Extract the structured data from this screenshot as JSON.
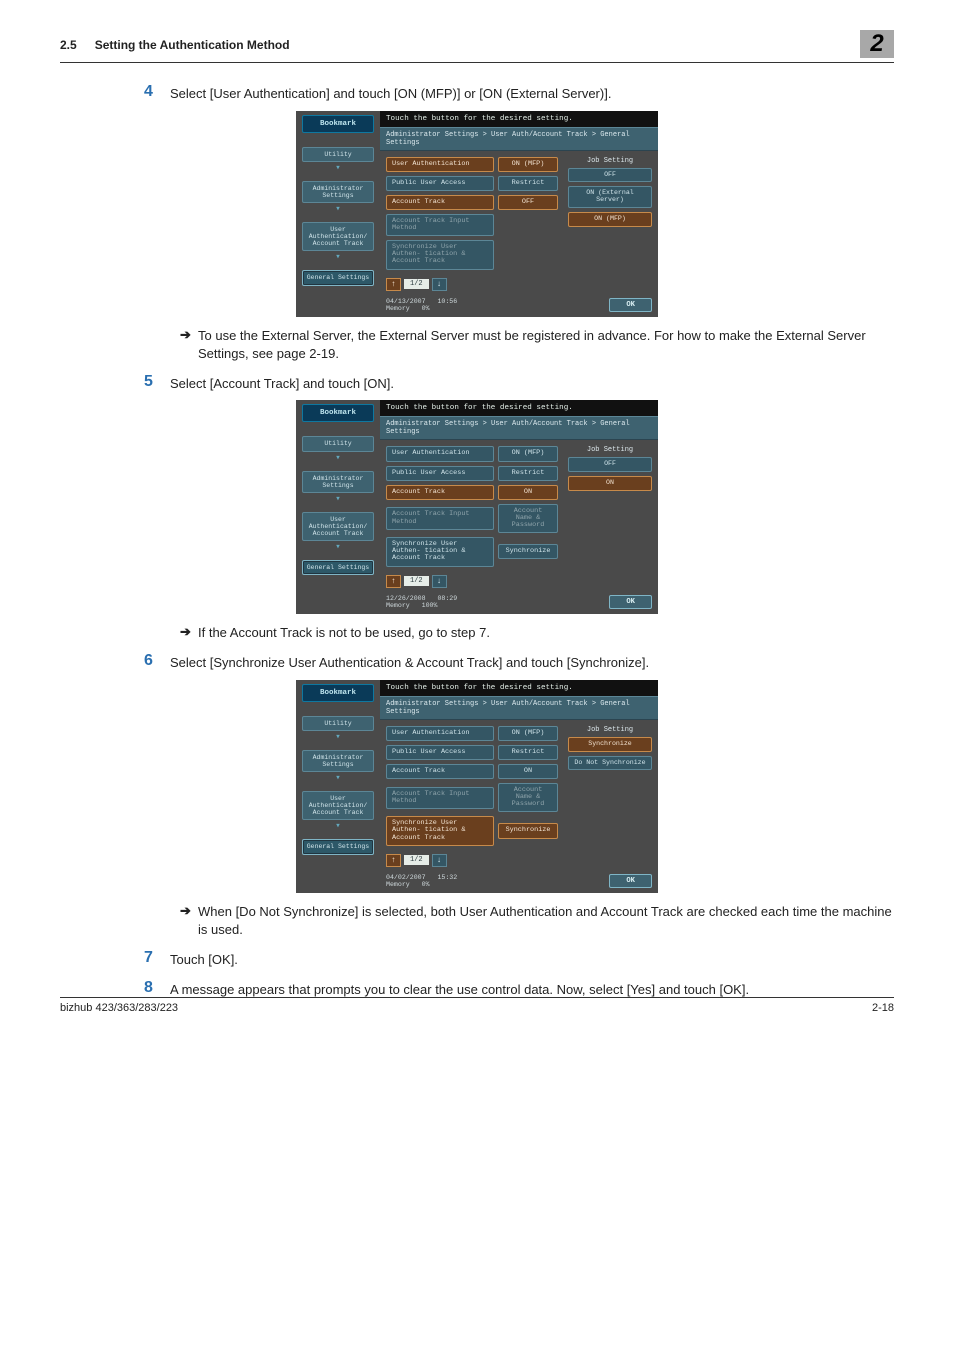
{
  "header": {
    "section_num": "2.5",
    "section_title": "Setting the Authentication Method",
    "chapter": "2"
  },
  "steps": {
    "s4": {
      "num": "4",
      "text": "Select [User Authentication] and touch [ON (MFP)] or [ON (External Server)]."
    },
    "n4": "To use the External Server, the External Server must be registered in advance. For how to make the External Server Settings, see page 2-19.",
    "s5": {
      "num": "5",
      "text": "Select [Account Track] and touch [ON]."
    },
    "n5": "If the Account Track is not to be used, go to step 7.",
    "s6": {
      "num": "6",
      "text": "Select [Synchronize User Authentication & Account Track] and touch [Synchronize]."
    },
    "n6": "When [Do Not Synchronize] is selected, both User Authentication and Account Track are checked each time the machine is used.",
    "s7": {
      "num": "7",
      "text": "Touch [OK]."
    },
    "s8": {
      "num": "8",
      "text": "A message appears that prompts you to clear the use control data. Now, select [Yes] and touch [OK]."
    }
  },
  "panel_common": {
    "title": "Touch the button for the desired setting.",
    "breadcrumb": "Administrator Settings > User Auth/Account Track  > General Settings",
    "bookmark": "Bookmark",
    "left_nav": [
      "Utility",
      "Administrator\nSettings",
      "User\nAuthentication/\nAccount Track",
      "General Settings"
    ],
    "job_setting": "Job Setting",
    "pager": "1/2",
    "ok": "OK",
    "memory_label": "Memory"
  },
  "panel1": {
    "rows": [
      {
        "label": "User Authentication",
        "val": "ON (MFP)",
        "sel": true
      },
      {
        "label": "Public User Access",
        "val": "Restrict"
      },
      {
        "label": "Account Track",
        "val": "OFF",
        "sel": true
      },
      {
        "label": "Account Track\nInput Method",
        "muted": true
      },
      {
        "label": "Synchronize User Authen-\ntication & Account Track",
        "muted": true
      }
    ],
    "side": [
      {
        "label": "OFF"
      },
      {
        "label": "ON\n(External Server)"
      },
      {
        "label": "ON (MFP)",
        "sel": true
      }
    ],
    "footer": {
      "date": "04/13/2007",
      "time": "10:56",
      "memory": "0%"
    }
  },
  "panel2": {
    "rows": [
      {
        "label": "User Authentication",
        "val": "ON (MFP)"
      },
      {
        "label": "Public User Access",
        "val": "Restrict"
      },
      {
        "label": "Account Track",
        "val": "ON",
        "sel": true
      },
      {
        "label": "Account Track\nInput Method",
        "val": "Account Name &\nPassword",
        "muted": true
      },
      {
        "label": "Synchronize User Authen-\ntication & Account Track",
        "val": "Synchronize"
      }
    ],
    "side": [
      {
        "label": "OFF"
      },
      {
        "label": "ON",
        "sel": true
      }
    ],
    "footer": {
      "date": "12/26/2008",
      "time": "08:29",
      "memory": "100%"
    }
  },
  "panel3": {
    "rows": [
      {
        "label": "User Authentication",
        "val": "ON (MFP)"
      },
      {
        "label": "Public User Access",
        "val": "Restrict"
      },
      {
        "label": "Account Track",
        "val": "ON"
      },
      {
        "label": "Account Track\nInput Method",
        "val": "Account Name &\nPassword",
        "muted": true
      },
      {
        "label": "Synchronize User Authen-\ntication & Account Track",
        "val": "Synchronize",
        "sel": true
      }
    ],
    "side": [
      {
        "label": "Synchronize",
        "sel": true
      },
      {
        "label": "Do Not\nSynchronize"
      }
    ],
    "footer": {
      "date": "04/02/2007",
      "time": "15:32",
      "memory": "0%"
    }
  },
  "footer": {
    "left": "bizhub 423/363/283/223",
    "right": "2-18"
  }
}
